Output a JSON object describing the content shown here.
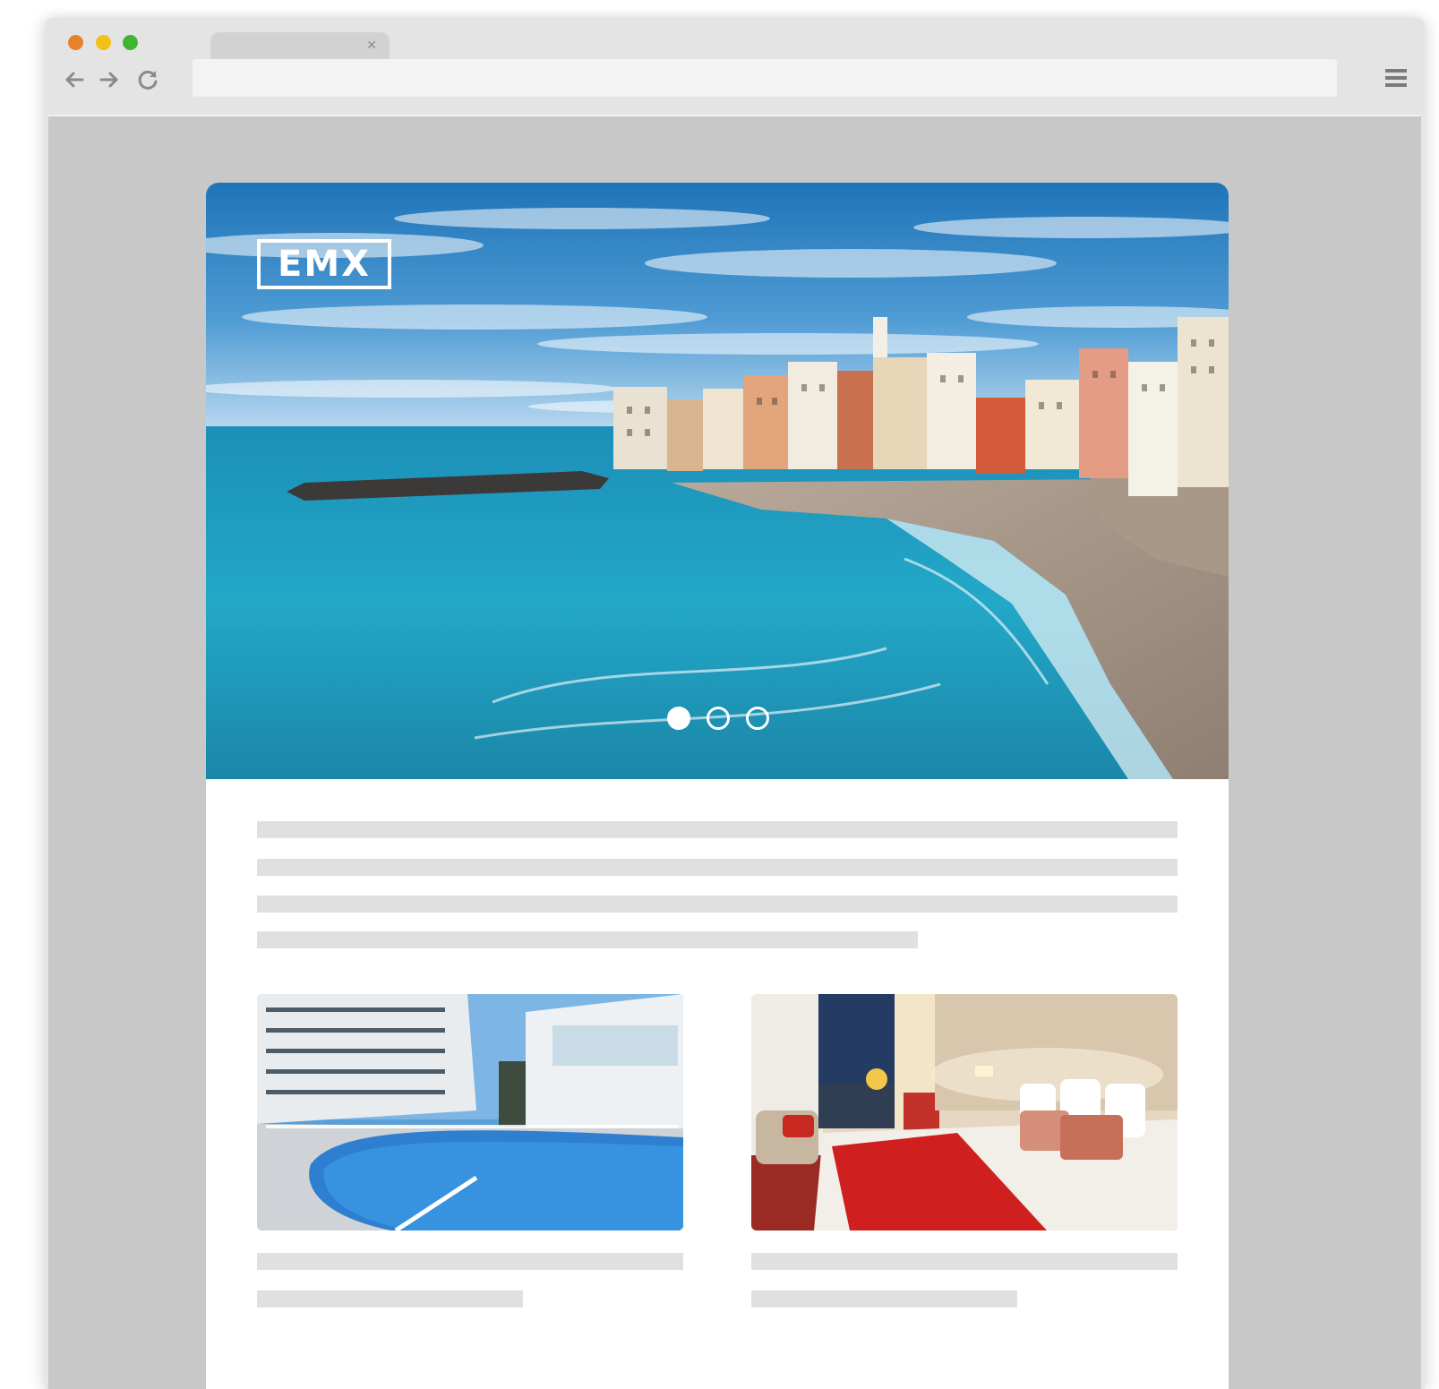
{
  "window": {
    "controls": {
      "close_color": "#e8822a",
      "minimize_color": "#f2c018",
      "maximize_color": "#3fb631"
    },
    "tab": {
      "title": "",
      "close_icon": "close-icon"
    },
    "nav": {
      "back_icon": "arrow-left-icon",
      "forward_icon": "arrow-right-icon",
      "reload_icon": "reload-icon"
    },
    "address_bar": {
      "value": "",
      "placeholder": ""
    },
    "menu_icon": "hamburger-menu-icon"
  },
  "page": {
    "hero": {
      "image": "coastal-town-beach-photo",
      "logo_text": "EMX",
      "carousel": {
        "slide_count": 3,
        "active_index": 0
      }
    },
    "intro_placeholder_lines": 4,
    "cards": [
      {
        "image": "hotel-pool-photo",
        "placeholder_lines": 2
      },
      {
        "image": "hotel-bedroom-photo",
        "placeholder_lines": 2
      }
    ]
  }
}
